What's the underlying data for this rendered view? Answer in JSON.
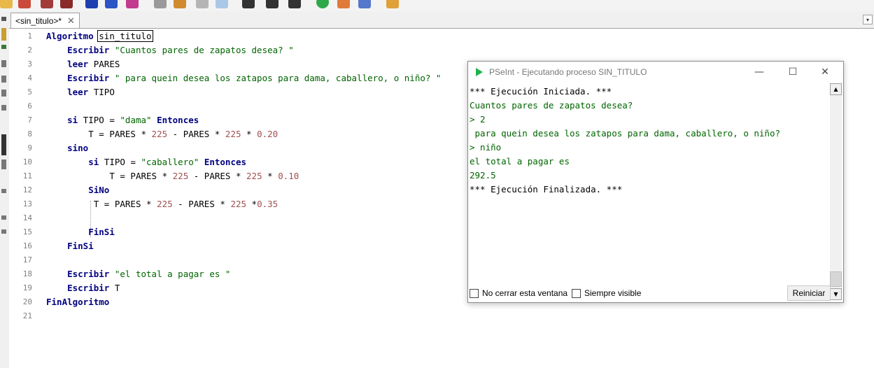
{
  "tab": {
    "title": "<sin_titulo>*",
    "close_glyph": "✕"
  },
  "editor": {
    "lines": [
      {
        "n": "1"
      },
      {
        "n": "2"
      },
      {
        "n": "3"
      },
      {
        "n": "4"
      },
      {
        "n": "5"
      },
      {
        "n": "6"
      },
      {
        "n": "7"
      },
      {
        "n": "8"
      },
      {
        "n": "9"
      },
      {
        "n": "10"
      },
      {
        "n": "11"
      },
      {
        "n": "12"
      },
      {
        "n": "13"
      },
      {
        "n": "14"
      },
      {
        "n": "15"
      },
      {
        "n": "16"
      },
      {
        "n": "17"
      },
      {
        "n": "18"
      },
      {
        "n": "19"
      },
      {
        "n": "20"
      },
      {
        "n": "21"
      }
    ],
    "tokens": {
      "l1_kw": "Algoritmo",
      "l1_name": "sin_titulo",
      "l2_kw": "Escribir",
      "l2_str": "\"Cuantos pares de zapatos desea? \"",
      "l3_kw": "leer",
      "l3_id": "PARES",
      "l4_kw": "Escribir",
      "l4_str": "\" para quein desea los zatapos para dama, caballero, o niño? \"",
      "l5_kw": "leer",
      "l5_id": "TIPO",
      "l7_kw": "si",
      "l7_id": "TIPO =",
      "l7_str": "\"dama\"",
      "l7_kw2": "Entonces",
      "l8_a": "T = PARES *",
      "l8_n1": "225",
      "l8_b": "- PARES *",
      "l8_n2": "225",
      "l8_c": "*",
      "l8_n3": "0.20",
      "l9_kw": "sino",
      "l10_kw": "si",
      "l10_id": "TIPO =",
      "l10_str": "\"caballero\"",
      "l10_kw2": "Entonces",
      "l11_a": "T = PARES *",
      "l11_n1": "225",
      "l11_b": "- PARES *",
      "l11_n2": "225",
      "l11_c": "*",
      "l11_n3": "0.10",
      "l12_kw": "SiNo",
      "l13_a": "T = PARES *",
      "l13_n1": "225",
      "l13_b": "- PARES *",
      "l13_n2": "225",
      "l13_c": "*",
      "l13_n3": "0.35",
      "l15_kw": "FinSi",
      "l16_kw": "FinSi",
      "l18_kw": "Escribir",
      "l18_str": "\"el total a pagar es \"",
      "l19_kw": "Escribir",
      "l19_id": "T",
      "l20_kw": "FinAlgoritmo"
    }
  },
  "run_window": {
    "title": "PSeInt - Ejecutando proceso SIN_TITULO",
    "minimize": "—",
    "maximize": "☐",
    "close": "✕",
    "console": [
      "*** Ejecución Iniciada. ***",
      "Cuantos pares de zapatos desea?",
      "> 2",
      " para quein desea los zatapos para dama, caballero, o niño?",
      "> niño",
      "el total a pagar es",
      "292.5",
      "*** Ejecución Finalizada. ***"
    ],
    "keep_open_label": "No cerrar esta ventana",
    "always_visible_label": "Siempre visible",
    "restart_label": "Reiniciar"
  }
}
